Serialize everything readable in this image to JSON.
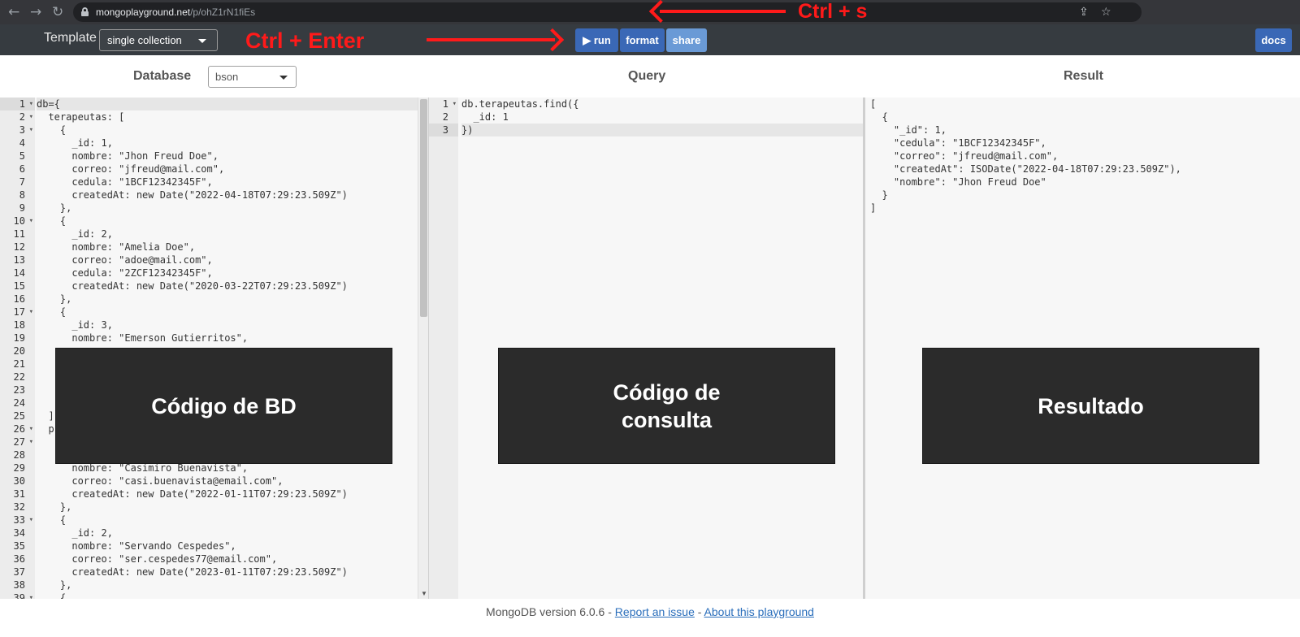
{
  "browser": {
    "url_host": "mongoplayground.net",
    "url_path": "/p/ohZ1rN1fiEs"
  },
  "navbar": {
    "template_label": "Template",
    "template_value": "single collection",
    "run_label": "▶ run",
    "format_label": "format",
    "share_label": "share",
    "docs_label": "docs"
  },
  "annotations": {
    "run_shortcut": "Ctrl + Enter",
    "save_shortcut": "Ctrl + s"
  },
  "panels": {
    "database_title": "Database",
    "database_mode": "bson",
    "query_title": "Query",
    "result_title": "Result"
  },
  "db_editor": {
    "line_numbers": [
      "1",
      "2",
      "3",
      "4",
      "5",
      "6",
      "7",
      "8",
      "9",
      "10",
      "11",
      "12",
      "13",
      "14",
      "15",
      "16",
      "17",
      "18",
      "19",
      "20",
      "21",
      "22",
      "23",
      "24",
      "25",
      "26",
      "27",
      "28",
      "29",
      "30",
      "31",
      "32",
      "33",
      "34",
      "35",
      "36",
      "37",
      "38",
      "39"
    ],
    "lines": [
      "db={",
      "  terapeutas: [",
      "    {",
      "      _id: 1,",
      "      nombre: \"Jhon Freud Doe\",",
      "      correo: \"jfreud@mail.com\",",
      "      cedula: \"1BCF12342345F\",",
      "      createdAt: new Date(\"2022-04-18T07:29:23.509Z\")",
      "    },",
      "    {",
      "      _id: 2,",
      "      nombre: \"Amelia Doe\",",
      "      correo: \"adoe@mail.com\",",
      "      cedula: \"2ZCF12342345F\",",
      "      createdAt: new Date(\"2020-03-22T07:29:23.509Z\")",
      "    },",
      "    {",
      "      _id: 3,",
      "      nombre: \"Emerson Gutierritos\",",
      "",
      "",
      "",
      "",
      "",
      "  ],",
      "  p",
      "",
      "",
      "      nombre: \"Casimiro Buenavista\",",
      "      correo: \"casi.buenavista@email.com\",",
      "      createdAt: new Date(\"2022-01-11T07:29:23.509Z\")",
      "    },",
      "    {",
      "      _id: 2,",
      "      nombre: \"Servando Cespedes\",",
      "      correo: \"ser.cespedes77@email.com\",",
      "      createdAt: new Date(\"2023-01-11T07:29:23.509Z\")",
      "    },",
      "    {"
    ]
  },
  "query_editor": {
    "line_numbers": [
      "1",
      "2",
      "3"
    ],
    "lines": [
      "db.terapeutas.find({",
      "  _id: 1",
      "})"
    ]
  },
  "result_editor": {
    "lines": [
      "[",
      "  {",
      "    \"_id\": 1,",
      "    \"cedula\": \"1BCF12342345F\",",
      "    \"correo\": \"jfreud@mail.com\",",
      "    \"createdAt\": ISODate(\"2022-04-18T07:29:23.509Z\"),",
      "    \"nombre\": \"Jhon Freud Doe\"",
      "  }",
      "]"
    ]
  },
  "overlays": {
    "db": "Código de BD",
    "query": "Código de consulta",
    "result": "Resultado"
  },
  "footer": {
    "version": "MongoDB version 6.0.6",
    "sep1": " - ",
    "report": "Report an issue",
    "sep2": " - ",
    "about": "About this playground"
  },
  "colors": {
    "navbar": "#363b40",
    "button_primary": "#3a68b6",
    "button_share": "#6a9ad6",
    "annotation": "#ff1a1a",
    "overlay": "#2b2b2b"
  }
}
